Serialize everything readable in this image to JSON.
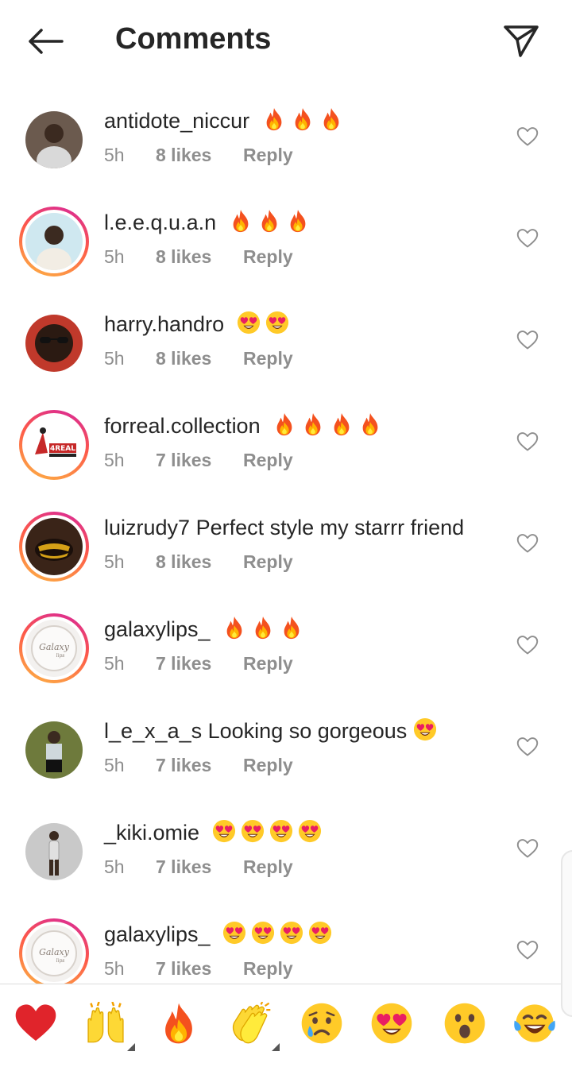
{
  "header": {
    "title": "Comments",
    "back_icon": "arrow-left-icon",
    "share_icon": "paper-plane-icon"
  },
  "comments": [
    {
      "username": "antidote_niccur",
      "text": "",
      "emojis": [
        "fire",
        "fire",
        "fire"
      ],
      "time": "5h",
      "likes": "8 likes",
      "reply": "Reply",
      "story_ring": false
    },
    {
      "username": "l.e.e.q.u.a.n",
      "text": "",
      "emojis": [
        "fire",
        "fire",
        "fire"
      ],
      "time": "5h",
      "likes": "8 likes",
      "reply": "Reply",
      "story_ring": true
    },
    {
      "username": "harry.handro",
      "text": "",
      "emojis": [
        "heart-eyes",
        "heart-eyes"
      ],
      "time": "5h",
      "likes": "8 likes",
      "reply": "Reply",
      "story_ring": false
    },
    {
      "username": "forreal.collection",
      "text": "",
      "emojis": [
        "fire",
        "fire",
        "fire",
        "fire"
      ],
      "time": "5h",
      "likes": "7 likes",
      "reply": "Reply",
      "story_ring": true
    },
    {
      "username": "luizrudy7",
      "text": "Perfect style my starrr friend",
      "emojis": [],
      "time": "5h",
      "likes": "8 likes",
      "reply": "Reply",
      "story_ring": true
    },
    {
      "username": "galaxylips_",
      "text": "",
      "emojis": [
        "fire",
        "fire",
        "fire"
      ],
      "time": "5h",
      "likes": "7 likes",
      "reply": "Reply",
      "story_ring": true
    },
    {
      "username": "l_e_x_a_s",
      "text": "Looking so gorgeous",
      "emojis": [
        "heart-eyes"
      ],
      "time": "5h",
      "likes": "7 likes",
      "reply": "Reply",
      "story_ring": false
    },
    {
      "username": "_kiki.omie",
      "text": "",
      "emojis": [
        "heart-eyes",
        "heart-eyes",
        "heart-eyes",
        "heart-eyes"
      ],
      "time": "5h",
      "likes": "7 likes",
      "reply": "Reply",
      "story_ring": false
    },
    {
      "username": "galaxylips_",
      "text": "",
      "emojis": [
        "heart-eyes",
        "heart-eyes",
        "heart-eyes",
        "heart-eyes"
      ],
      "time": "5h",
      "likes": "7 likes",
      "reply": "Reply",
      "story_ring": true
    }
  ],
  "avatar_logos": {
    "forreal": "4REAL",
    "galaxy": "Galaxy"
  },
  "quick_reactions": [
    "red-heart",
    "raising-hands",
    "fire",
    "clapping-hands",
    "crying-face",
    "heart-eyes",
    "surprised-face",
    "tears-of-joy"
  ],
  "colors": {
    "text": "#262626",
    "meta": "#8e8e8e",
    "story_ring_start": "#d6249f",
    "story_ring_end": "#fdb444"
  }
}
